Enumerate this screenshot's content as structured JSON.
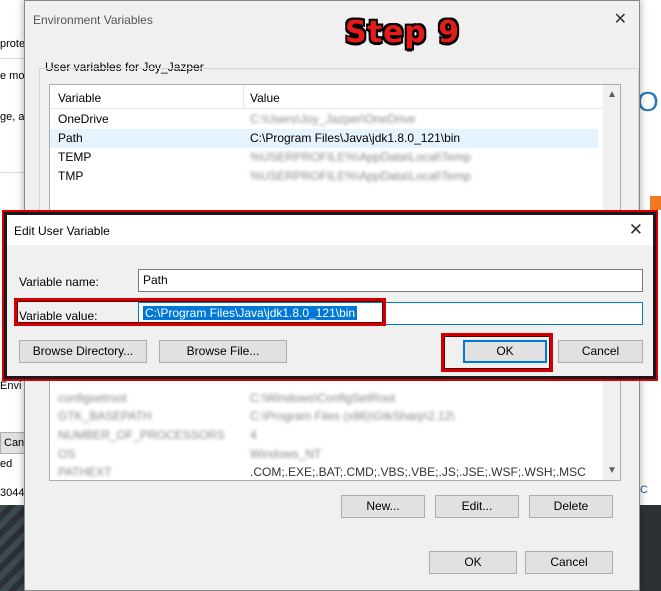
{
  "background": {
    "fragments": [
      "protec",
      "e mos",
      "ge, an",
      "Envi",
      "Canc",
      "ed",
      "3044"
    ],
    "right_glyph": "O",
    "right_logo_text": "C"
  },
  "env_window": {
    "title": "Environment Variables",
    "step_label": "Step 9",
    "user_group_label": "User variables for Joy_Jazper",
    "columns": [
      "Variable",
      "Value"
    ],
    "user_vars": [
      {
        "name": "OneDrive",
        "value": "C:\\Users\\Joy_Jazper\\OneDrive"
      },
      {
        "name": "Path",
        "value": "C:\\Program Files\\Java\\jdk1.8.0_121\\bin"
      },
      {
        "name": "TEMP",
        "value": "%USERPROFILE%\\AppData\\Local\\Temp"
      },
      {
        "name": "TMP",
        "value": "%USERPROFILE%\\AppData\\Local\\Temp"
      }
    ],
    "system_vars": [
      {
        "name": "configsetroot",
        "value": "C:\\Windows\\ConfigSetRoot"
      },
      {
        "name": "GTK_BASEPATH",
        "value": "C:\\Program Files (x86)\\GtkSharp\\2.12\\"
      },
      {
        "name": "NUMBER_OF_PROCESSORS",
        "value": "4"
      },
      {
        "name": "OS",
        "value": "Windows_NT"
      },
      {
        "name": "PATHEXT",
        "value": ".COM;.EXE;.BAT;.CMD;.VBS;.VBE;.JS;.JSE;.WSF;.WSH;.MSC"
      }
    ],
    "buttons": {
      "new": "New...",
      "edit": "Edit...",
      "delete": "Delete",
      "ok": "OK",
      "cancel": "Cancel"
    }
  },
  "edit_dialog": {
    "title": "Edit User Variable",
    "name_label": "Variable name:",
    "name_value": "Path",
    "value_label": "Variable value:",
    "value_value": "C:\\Program Files\\Java\\jdk1.8.0_121\\bin",
    "buttons": {
      "browse_dir": "Browse Directory...",
      "browse_file": "Browse File...",
      "ok": "OK",
      "cancel": "Cancel"
    }
  },
  "colors": {
    "highlight": "#d40000",
    "selection": "#0078d7",
    "accent_text": "#e41b1b"
  },
  "icons": [
    "close-icon",
    "scroll-up-icon",
    "scroll-down-icon"
  ]
}
